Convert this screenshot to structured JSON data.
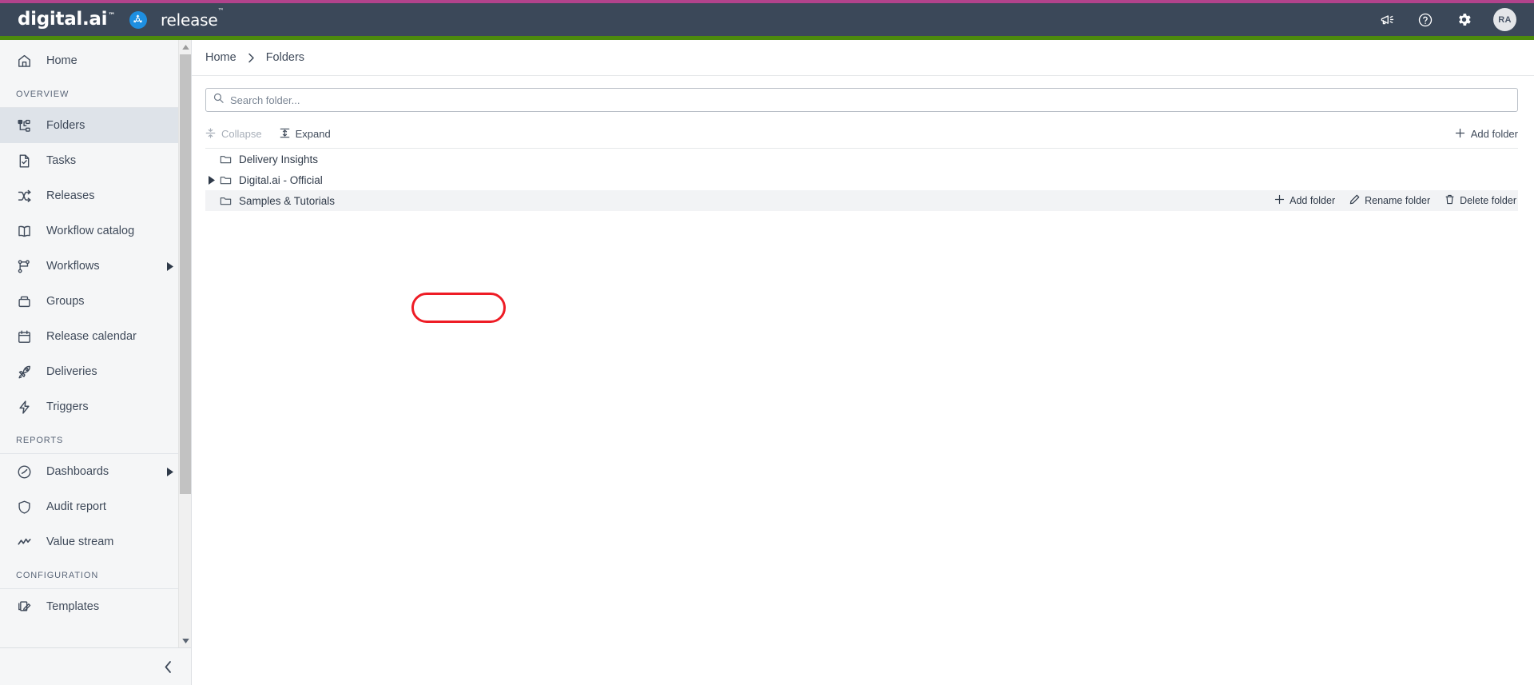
{
  "header": {
    "brand_name": "digital.ai",
    "brand_tm": "™",
    "product_name": "release",
    "product_tm": "™",
    "icons": [
      {
        "name": "announcements-icon",
        "label": "Announcements"
      },
      {
        "name": "help-icon",
        "label": "Help"
      },
      {
        "name": "settings-gear-icon",
        "label": "Settings"
      }
    ],
    "avatar_initials": "RA",
    "accent_top_color": "#b2438c",
    "accent_bottom_color": "#4c8a0c",
    "bar_color": "#3b4859"
  },
  "sidebar": {
    "home": {
      "label": "Home",
      "icon": "home-icon"
    },
    "sections": [
      {
        "title": "OVERVIEW",
        "items": [
          {
            "label": "Folders",
            "icon": "folders-icon",
            "active": true,
            "caret": false
          },
          {
            "label": "Tasks",
            "icon": "tasks-icon",
            "active": false,
            "caret": false
          },
          {
            "label": "Releases",
            "icon": "releases-icon",
            "active": false,
            "caret": false
          },
          {
            "label": "Workflow catalog",
            "icon": "workflow-catalog-icon",
            "active": false,
            "caret": false
          },
          {
            "label": "Workflows",
            "icon": "workflows-icon",
            "active": false,
            "caret": true
          },
          {
            "label": "Groups",
            "icon": "groups-icon",
            "active": false,
            "caret": false
          },
          {
            "label": "Release calendar",
            "icon": "calendar-icon",
            "active": false,
            "caret": false
          },
          {
            "label": "Deliveries",
            "icon": "rocket-icon",
            "active": false,
            "caret": false
          },
          {
            "label": "Triggers",
            "icon": "lightning-icon",
            "active": false,
            "caret": false
          }
        ]
      },
      {
        "title": "REPORTS",
        "items": [
          {
            "label": "Dashboards",
            "icon": "dashboards-icon",
            "active": false,
            "caret": true
          },
          {
            "label": "Audit report",
            "icon": "shield-icon",
            "active": false,
            "caret": false
          },
          {
            "label": "Value stream",
            "icon": "value-stream-icon",
            "active": false,
            "caret": false
          }
        ]
      },
      {
        "title": "CONFIGURATION",
        "items": [
          {
            "label": "Templates",
            "icon": "templates-icon",
            "active": false,
            "caret": false
          }
        ]
      }
    ],
    "collapse_icon": "chevron-left-icon"
  },
  "breadcrumb": {
    "items": [
      "Home",
      "Folders"
    ],
    "separator_icon": "chevron-right-icon"
  },
  "search": {
    "placeholder": "Search folder...",
    "value": "",
    "icon": "search-icon"
  },
  "toolbar": {
    "collapse_label": "Collapse",
    "collapse_disabled": true,
    "collapse_icon": "collapse-icon",
    "expand_label": "Expand",
    "expand_disabled": false,
    "expand_icon": "expand-icon",
    "add_folder_label": "Add folder",
    "add_folder_icon": "plus-icon"
  },
  "tree": {
    "rows": [
      {
        "label": "Delivery Insights",
        "has_caret": false,
        "expanded": false,
        "hovered": false,
        "annotated": true,
        "icon": "folder-icon"
      },
      {
        "label": "Digital.ai - Official",
        "has_caret": true,
        "expanded": false,
        "hovered": false,
        "annotated": false,
        "icon": "folder-icon"
      },
      {
        "label": "Samples & Tutorials",
        "has_caret": false,
        "expanded": false,
        "hovered": true,
        "annotated": false,
        "icon": "folder-icon"
      }
    ],
    "row_actions": {
      "add_folder_label": "Add folder",
      "add_folder_icon": "plus-icon",
      "rename_folder_label": "Rename folder",
      "rename_folder_icon": "pencil-icon",
      "delete_folder_label": "Delete folder",
      "delete_folder_icon": "trash-icon"
    }
  },
  "annotation": {
    "color": "#ee1c25"
  }
}
